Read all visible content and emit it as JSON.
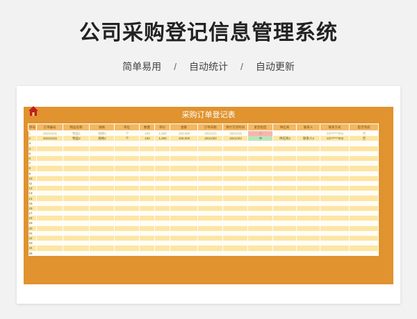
{
  "header": {
    "title": "公司采购登记信息管理系统",
    "features": [
      "简单易用",
      "自动统计",
      "自动更新"
    ],
    "separator": "/"
  },
  "sheet": {
    "title": "采购订单登记表",
    "columns": [
      "序号",
      "订单编号",
      "物品名称",
      "规格",
      "单位",
      "数量",
      "单价",
      "金额",
      "订单日期",
      "预计交货时间",
      "紧急程度",
      "供应商",
      "联系人",
      "联系方式",
      "是否完成"
    ],
    "rows": [
      {
        "no": "1",
        "order": "20210101",
        "item": "物品1",
        "spec": "规格1",
        "unit": "个",
        "qty": "100",
        "price": "1,000",
        "amount": "100,000",
        "date": "2021/1/1",
        "eta": "2021/1/5",
        "urgency": "高",
        "supplier": "",
        "contact": "",
        "phone": "1377****001",
        "done": "否"
      },
      {
        "no": "2",
        "order": "20210102",
        "item": "物品2",
        "spec": "规格2",
        "unit": "个",
        "qty": "100",
        "price": "1,000",
        "amount": "100,000",
        "date": "2021/3/2",
        "eta": "2021/3/3",
        "urgency": "中",
        "supplier": "供应商2",
        "contact": "联系人2",
        "phone": "1377****002",
        "done": "否"
      }
    ],
    "empty_rows": [
      "3",
      "4",
      "5",
      "6",
      "7",
      "8",
      "9",
      "10",
      "11",
      "12",
      "13",
      "14",
      "15",
      "16",
      "17",
      "18",
      "19",
      "20",
      "21",
      "22",
      "23",
      "24",
      "25"
    ]
  },
  "colors": {
    "frame": "#e0932e",
    "header_cell": "#f2b862",
    "row_odd": "#fde6a4",
    "row_even": "#fffdf6",
    "urgency_high": "#f8b5b0",
    "urgency_mid": "#bfe3b8",
    "home_icon": "#c0201c"
  }
}
